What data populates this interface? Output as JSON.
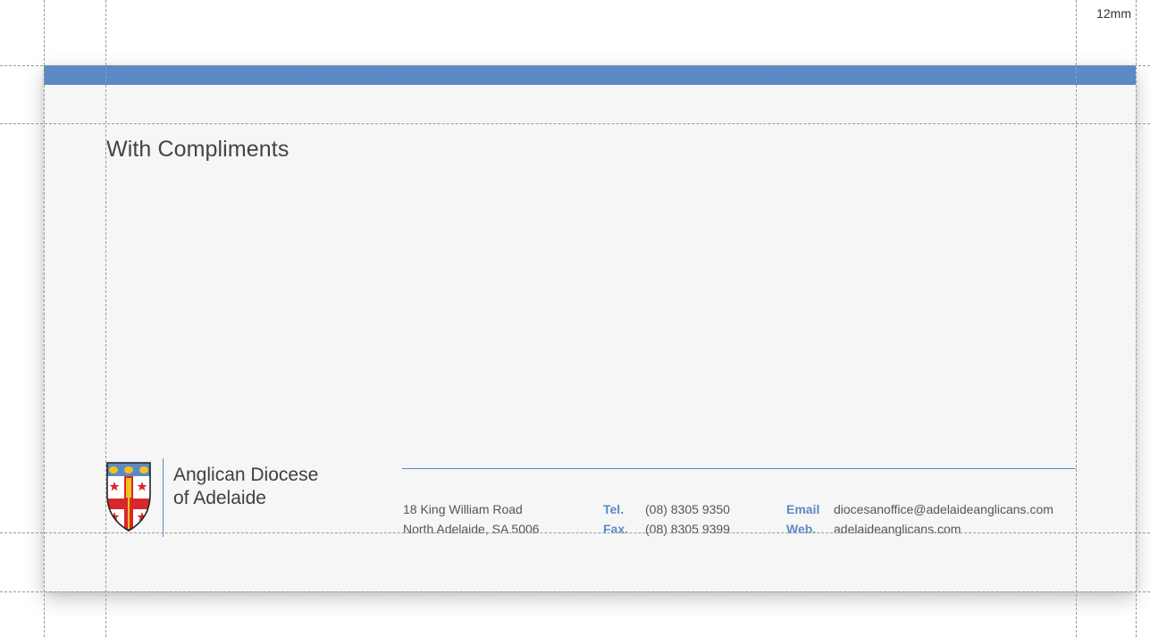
{
  "card": {
    "title": "With Compliments",
    "organisation": {
      "line1": "Anglican Diocese",
      "line2": "of Adelaide"
    },
    "address": {
      "line1": "18 King William Road",
      "line2": "North Adelaide, SA 5006"
    },
    "phone": {
      "tel_label": "Tel.",
      "tel": "(08) 8305 9350",
      "fax_label": "Fax.",
      "fax": "(08) 8305 9399"
    },
    "online": {
      "email_label": "Email",
      "email": "diocesanoffice@adelaideanglicans.com",
      "web_label": "Web.",
      "web": "adelaideanglicans.com"
    }
  },
  "guides": {
    "margin_label": "12mm"
  },
  "colors": {
    "accent": "#5b8ac6",
    "paper": "#f6f6f6",
    "crest_red": "#d8262c",
    "crest_gold": "#f2c21b"
  },
  "icons": {
    "crest": "diocese-coat-of-arms-icon"
  }
}
